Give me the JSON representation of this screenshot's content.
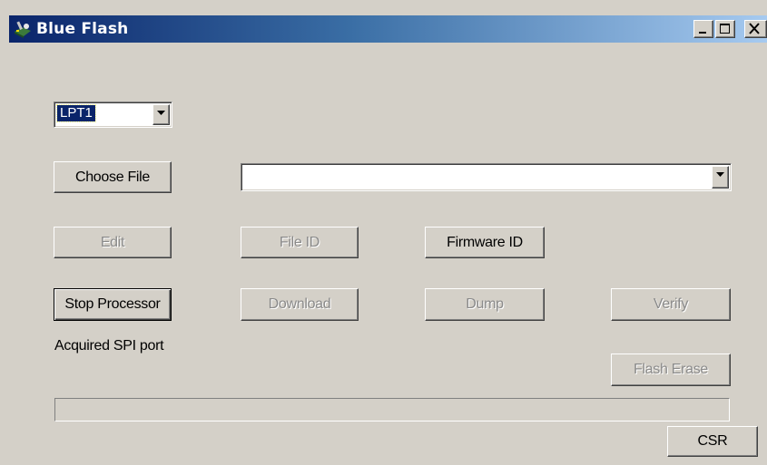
{
  "window": {
    "title": "Blue Flash",
    "controls": [
      "minimize",
      "maximize",
      "close"
    ]
  },
  "port_select": {
    "value": "LPT1"
  },
  "file": {
    "choose_label": "Choose File",
    "path_value": ""
  },
  "buttons": {
    "edit": "Edit",
    "file_id": "File ID",
    "firmware_id": "Firmware ID",
    "stop_processor": "Stop Processor",
    "download": "Download",
    "dump": "Dump",
    "verify": "Verify",
    "flash_erase": "Flash Erase",
    "csr": "CSR"
  },
  "status": {
    "message": "Acquired SPI port"
  },
  "progress": {
    "fraction": 0
  },
  "colors": {
    "title_start": "#0a246a",
    "title_end": "#a6caf0",
    "face": "#d4d0c8",
    "disabled_text": "#8a8a8a"
  }
}
